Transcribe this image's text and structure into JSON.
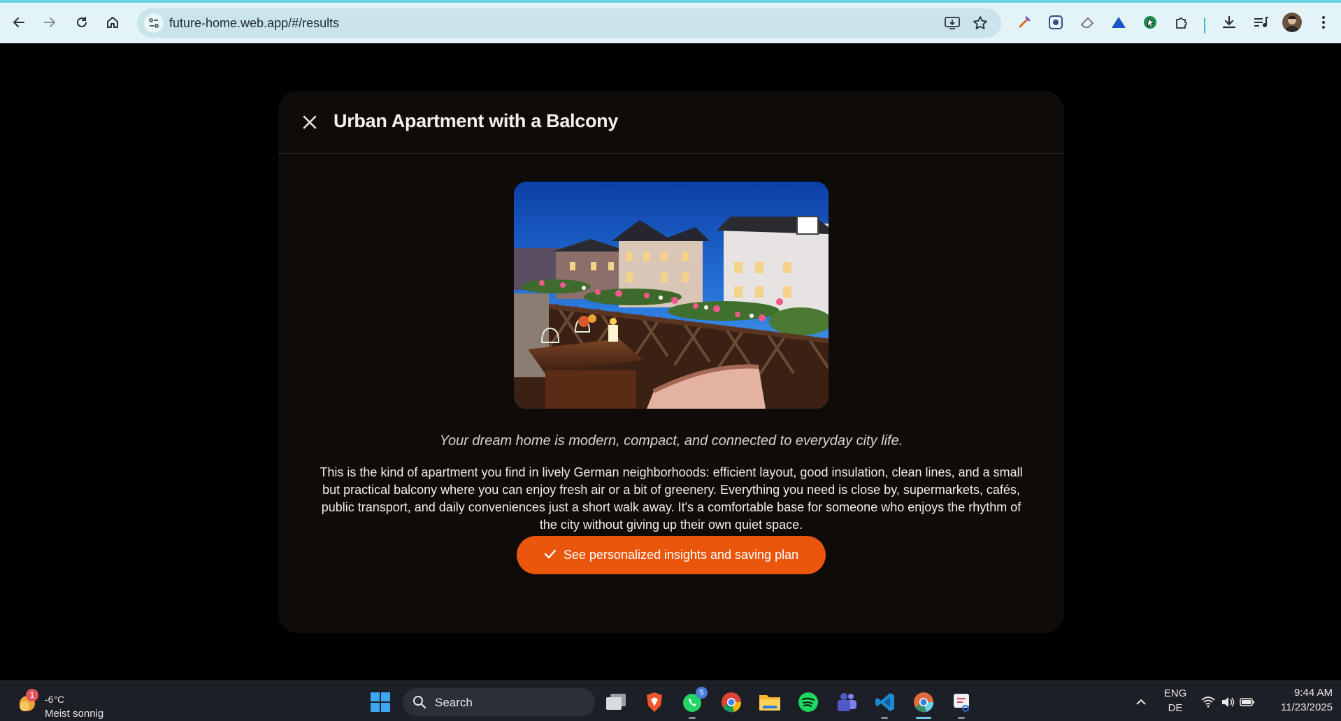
{
  "browser": {
    "url": "future-home.web.app/#/results",
    "nav": [
      "back-icon",
      "forward-icon",
      "reload-icon",
      "home-icon"
    ],
    "accent": "#6fd3e6"
  },
  "modal": {
    "title": "Urban Apartment with a Balcony",
    "tagline": "Your dream home is modern, compact, and connected to everyday city life.",
    "description": "This is the kind of apartment you find in lively German neighborhoods: efficient layout, good insulation, clean lines, and a small but practical balcony where you can enjoy fresh air or a bit of greenery. Everything you need is close by, supermarkets, cafés, public transport, and daily conveniences just a short walk away. It's a comfortable base for someone who enjoys the rhythm of the city without giving up their own quiet space.",
    "cta_label": "See personalized insights and saving plan",
    "cta_color": "#e9560c"
  },
  "taskbar": {
    "weather_badge": "1",
    "temperature": "-6°C",
    "weather_desc": "Meist sonnig",
    "search_label": "Search",
    "whatsapp_badge": "5",
    "lang_top": "ENG",
    "lang_bottom": "DE",
    "time": "9:44 AM",
    "date": "11/23/2025"
  }
}
